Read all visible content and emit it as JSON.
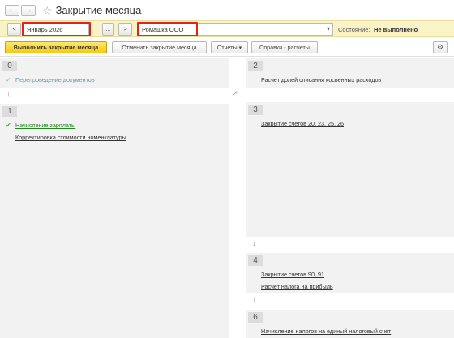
{
  "window": {
    "title": "Закрытие месяца",
    "back_glyph": "←",
    "forward_glyph": "→",
    "star_glyph": "☆"
  },
  "params": {
    "prev_glyph": "<",
    "period": "Январь 2026",
    "picker_glyph": "...",
    "next_glyph": ">",
    "organization": "Ромашка ООО",
    "dropdown_glyph": "▾",
    "state_label": "Состояние:",
    "state_value": "Не выполнено"
  },
  "actions": {
    "execute": "Выполнить закрытие месяца",
    "cancel": "Отменить закрытие месяца",
    "reports": "Отчеты ▾",
    "calculations": "Справки - расчеты",
    "settings_glyph": "⚙"
  },
  "down_arrow": "↓",
  "expand_glyph": "↗",
  "stages_left": [
    {
      "number": "0",
      "tasks": [
        {
          "label": "Перепроведение документов",
          "check": "✓"
        }
      ]
    },
    {
      "number": "1",
      "tasks": [
        {
          "label": "Начисление зарплаты",
          "check": "✔"
        },
        {
          "label": "Корректировка стоимости номенклатуры",
          "check": ""
        }
      ]
    }
  ],
  "stages_right": [
    {
      "number": "2",
      "tasks": [
        {
          "label": "Расчет долей списания косвенных расходов"
        }
      ]
    },
    {
      "number": "3",
      "tasks": [
        {
          "label": "Закрытие счетов 20, 23, 25, 26"
        }
      ]
    },
    {
      "number": "4",
      "tasks": [
        {
          "label": "Закрытие счетов 90, 91"
        },
        {
          "label": "Расчет налога на прибыль"
        }
      ]
    },
    {
      "number": "6",
      "tasks": [
        {
          "label": "Начисление налогов на единый налоговый счет"
        }
      ]
    }
  ]
}
